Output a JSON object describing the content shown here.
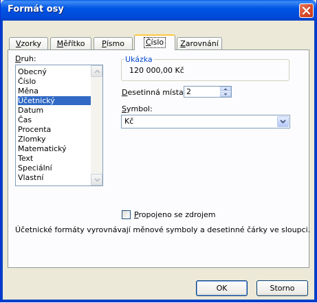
{
  "window": {
    "title": "Formát osy"
  },
  "tabs": [
    {
      "label": "Vzorky",
      "ul": "V",
      "rest": "zorky",
      "active": false
    },
    {
      "label": "Měřítko",
      "ul": "M",
      "rest": "ěřítko",
      "active": false
    },
    {
      "label": "Písmo",
      "ul": "P",
      "rest": "ísmo",
      "active": false
    },
    {
      "label": "Číslo",
      "ul": "Č",
      "rest": "íslo",
      "active": true
    },
    {
      "label": "Zarovnání",
      "ul": "Z",
      "rest": "arovnání",
      "active": false
    }
  ],
  "category": {
    "label_ul": "D",
    "label_rest": "ruh:",
    "items": [
      "Obecný",
      "Číslo",
      "Měna",
      "Účetnický",
      "Datum",
      "Čas",
      "Procenta",
      "Zlomky",
      "Matematický",
      "Text",
      "Speciální",
      "Vlastní"
    ],
    "selected": "Účetnický"
  },
  "sample": {
    "legend": "Ukázka",
    "value": "120 000,00 Kč"
  },
  "decimals": {
    "label_ul": "D",
    "label_rest": "esetinná místa:",
    "value": "2"
  },
  "symbol": {
    "label_ul": "S",
    "label_rest": "ymbol:",
    "value": "Kč"
  },
  "linked": {
    "label_ul": "P",
    "label_rest": "ropojeno se zdrojem",
    "checked": false
  },
  "description": "Účetnické formáty vyrovnávají měnové symboly a desetinné čárky ve sloupci.",
  "buttons": {
    "ok": "OK",
    "cancel": "Storno"
  }
}
